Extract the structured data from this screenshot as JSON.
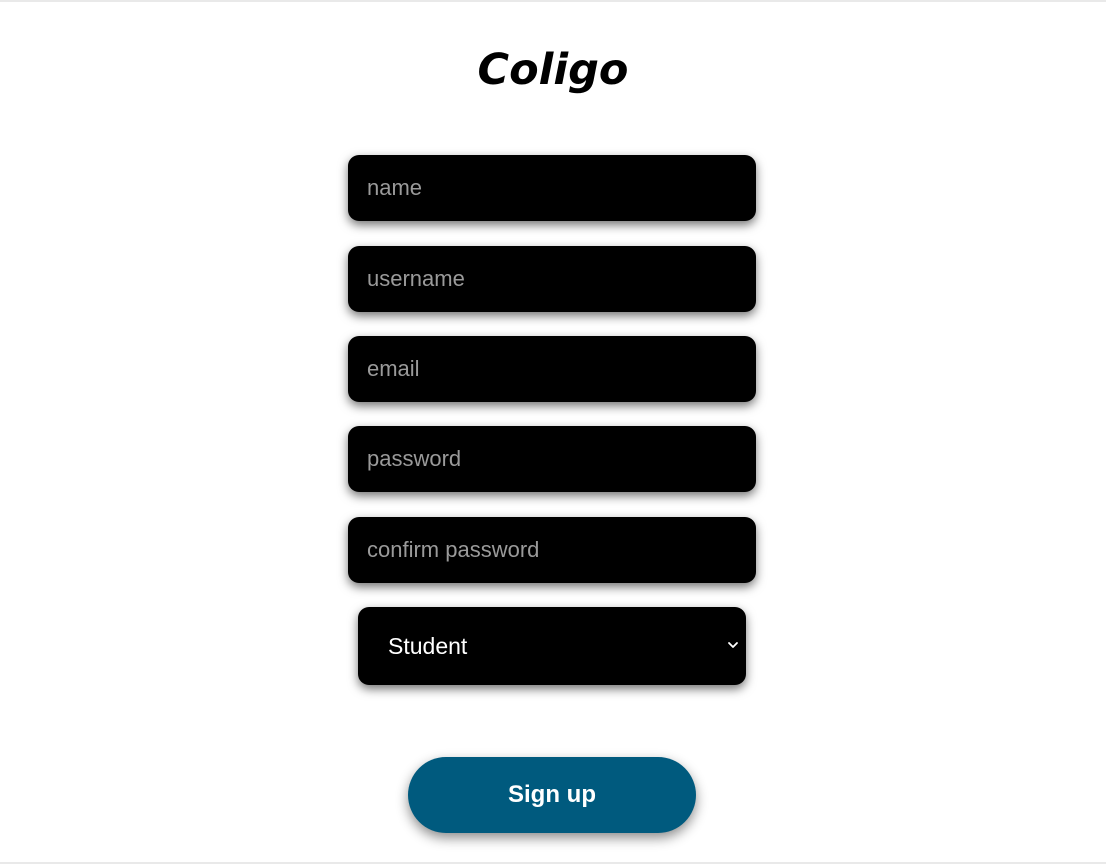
{
  "brand": {
    "title": "Coligo"
  },
  "form": {
    "name_placeholder": "name",
    "username_placeholder": "username",
    "email_placeholder": "email",
    "password_placeholder": "password",
    "confirm_password_placeholder": "confirm password",
    "role": {
      "selected": "Student",
      "icon": "chevron-down-icon"
    },
    "submit_label": "Sign up"
  },
  "colors": {
    "background": "#ffffff",
    "field_background": "#000000",
    "placeholder_text": "#9a9a9a",
    "button_background": "#005a7e",
    "button_text": "#ffffff"
  }
}
